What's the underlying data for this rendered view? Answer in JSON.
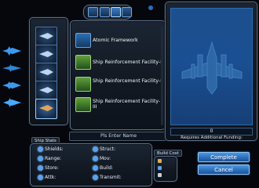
{
  "toolbar": {
    "icons": [
      "wrench-icon",
      "grid-icon",
      "blueprint-icon",
      "tools-icon"
    ]
  },
  "list": {
    "items": [
      {
        "label": "Atomic Framework",
        "icon_color": "#2d6db3"
      },
      {
        "label": "Ship Reinforcement Facility-I",
        "icon_color": "#5fa13c"
      },
      {
        "label": "Ship Reinforcement Facility-II",
        "icon_color": "#5fa13c"
      },
      {
        "label": "Ship Reinforcement Facility-III",
        "icon_color": "#5fa13c"
      }
    ]
  },
  "name_field": {
    "placeholder": "Pls Enter Name"
  },
  "stats_tab": "Ship Stats",
  "stats": {
    "left": [
      "Shields:",
      "Range:",
      "Store:",
      "Attk:"
    ],
    "right": [
      "Struct:",
      "Mov:",
      "Build:",
      "Transmit:"
    ]
  },
  "build_cost_tab": "Build Cost",
  "funding": {
    "value": "0",
    "label": "Requires Additional Funding:"
  },
  "buttons": {
    "complete": "Complete",
    "cancel": "Cancel"
  },
  "colors": {
    "accent": "#2d6ebb",
    "panel_border": "#5c6f86",
    "preview_bg": "#1a4f93"
  }
}
